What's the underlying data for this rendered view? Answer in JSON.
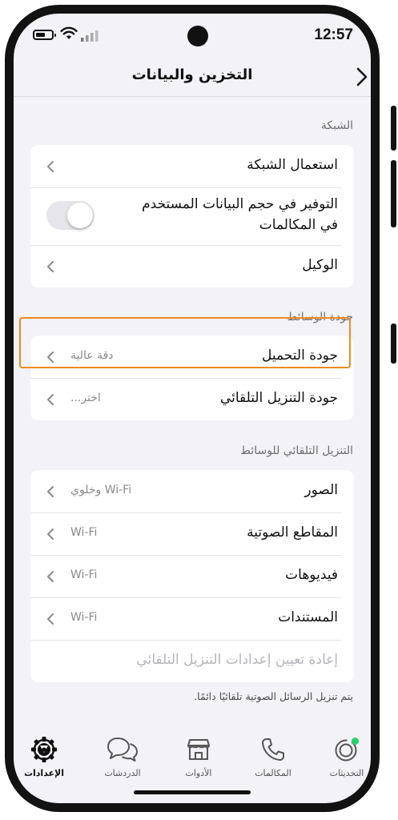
{
  "status_bar": {
    "time": "12:57"
  },
  "header": {
    "title": "التخزين والبيانات"
  },
  "sections": {
    "network": {
      "header": "الشبكة",
      "network_usage": "استعمال الشبكة",
      "use_less_data_line1": "التوفير في حجم البيانات المستخدم",
      "use_less_data_line2": "في المكالمات",
      "use_less_data_toggle": "off",
      "proxy": "الوكيل"
    },
    "media_quality": {
      "header": "جودة الوسائط",
      "upload_quality": "جودة التحميل",
      "upload_quality_value": "دقة عالية",
      "auto_download_quality": "جودة التنزيل التلقائي",
      "auto_download_quality_value": "اختر..."
    },
    "media_auto_download": {
      "header": "التنزيل التلقائي للوسائط",
      "photos": "الصور",
      "photos_value": "Wi-Fi وخلوي",
      "audio": "المقاطع الصوتية",
      "audio_value": "Wi-Fi",
      "videos": "فيديوهات",
      "videos_value": "Wi-Fi",
      "documents": "المستندات",
      "documents_value": "Wi-Fi",
      "reset": "إعادة تعيين إعدادات التنزيل التلقائي"
    },
    "footer_note": "يتم تنزيل الرسائل الصوتية تلقائيًا دائمًا."
  },
  "tabbar": {
    "updates": "التحديثات",
    "calls": "المكالمات",
    "tools": "الأدوات",
    "chats": "الدردشات",
    "settings": "الإعدادات",
    "active": "settings"
  },
  "colors": {
    "highlight": "#f08a1c",
    "updates_dot": "#25d366"
  }
}
